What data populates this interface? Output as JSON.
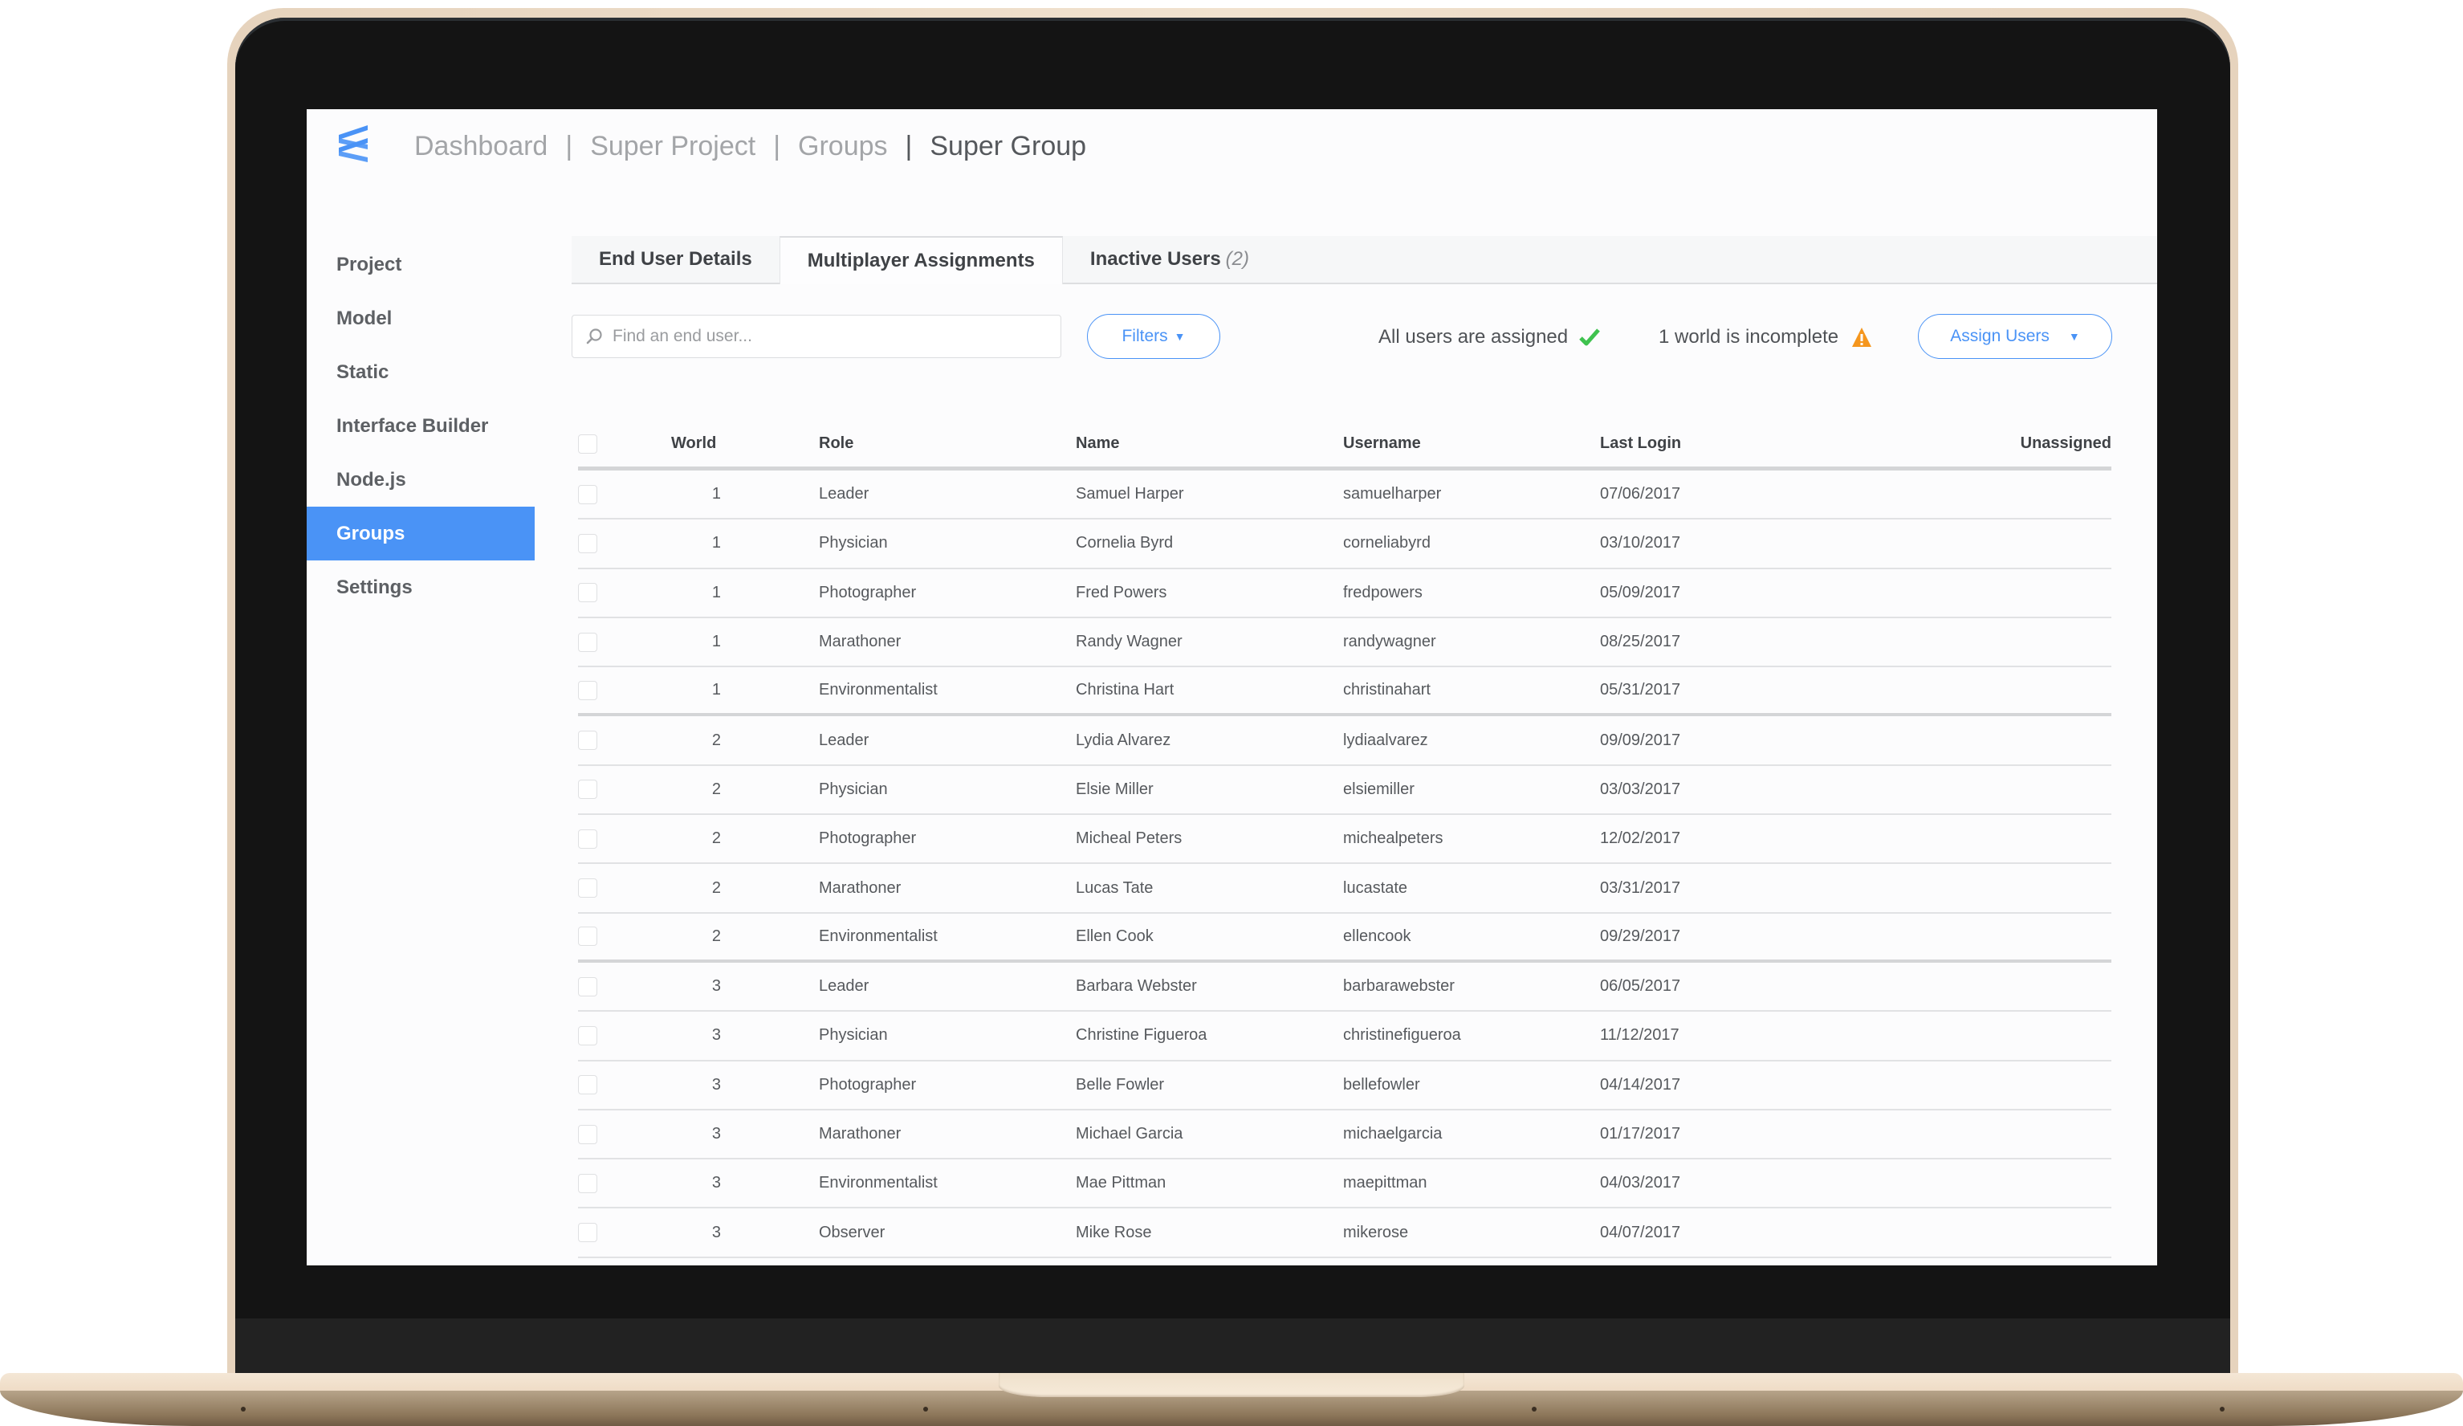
{
  "breadcrumb": [
    "Dashboard",
    "Super Project",
    "Groups",
    "Super Group"
  ],
  "sidebar": {
    "items": [
      {
        "label": "Project",
        "active": false
      },
      {
        "label": "Model",
        "active": false
      },
      {
        "label": "Static",
        "active": false
      },
      {
        "label": "Interface Builder",
        "active": false
      },
      {
        "label": "Node.js",
        "active": false
      },
      {
        "label": "Groups",
        "active": true
      },
      {
        "label": "Settings",
        "active": false
      }
    ]
  },
  "tabs": [
    {
      "label": "End User Details",
      "count": "",
      "active": false
    },
    {
      "label": "Multiplayer Assignments",
      "count": "",
      "active": true
    },
    {
      "label": "Inactive Users",
      "count": "(2)",
      "active": false
    }
  ],
  "toolbar": {
    "search_placeholder": "Find an end user...",
    "search_value": "",
    "filters_label": "Filters",
    "status_assigned": "All users are assigned",
    "status_incomplete": "1 world is incomplete",
    "assign_label": "Assign Users"
  },
  "colors": {
    "accent": "#4a93f6",
    "success": "#3fc24f",
    "warning": "#f5961e"
  },
  "table": {
    "headers": {
      "world": "World",
      "role": "Role",
      "name": "Name",
      "username": "Username",
      "last_login": "Last Login",
      "unassigned": "Unassigned"
    },
    "rows": [
      {
        "world": "1",
        "role": "Leader",
        "name": "Samuel Harper",
        "username": "samuelharper",
        "last_login": "07/06/2017",
        "unassigned": ""
      },
      {
        "world": "1",
        "role": "Physician",
        "name": "Cornelia Byrd",
        "username": "corneliabyrd",
        "last_login": "03/10/2017",
        "unassigned": ""
      },
      {
        "world": "1",
        "role": "Photographer",
        "name": "Fred Powers",
        "username": "fredpowers",
        "last_login": "05/09/2017",
        "unassigned": ""
      },
      {
        "world": "1",
        "role": "Marathoner",
        "name": "Randy Wagner",
        "username": "randywagner",
        "last_login": "08/25/2017",
        "unassigned": ""
      },
      {
        "world": "1",
        "role": "Environmentalist",
        "name": "Christina Hart",
        "username": "christinahart",
        "last_login": "05/31/2017",
        "unassigned": ""
      },
      {
        "world": "2",
        "role": "Leader",
        "name": "Lydia Alvarez",
        "username": "lydiaalvarez",
        "last_login": "09/09/2017",
        "unassigned": ""
      },
      {
        "world": "2",
        "role": "Physician",
        "name": "Elsie Miller",
        "username": "elsiemiller",
        "last_login": "03/03/2017",
        "unassigned": ""
      },
      {
        "world": "2",
        "role": "Photographer",
        "name": "Micheal Peters",
        "username": "michealpeters",
        "last_login": "12/02/2017",
        "unassigned": ""
      },
      {
        "world": "2",
        "role": "Marathoner",
        "name": "Lucas Tate",
        "username": "lucastate",
        "last_login": "03/31/2017",
        "unassigned": ""
      },
      {
        "world": "2",
        "role": "Environmentalist",
        "name": "Ellen Cook",
        "username": "ellencook",
        "last_login": "09/29/2017",
        "unassigned": ""
      },
      {
        "world": "3",
        "role": "Leader",
        "name": "Barbara Webster",
        "username": "barbarawebster",
        "last_login": "06/05/2017",
        "unassigned": ""
      },
      {
        "world": "3",
        "role": "Physician",
        "name": "Christine Figueroa",
        "username": "christinefigueroa",
        "last_login": "11/12/2017",
        "unassigned": ""
      },
      {
        "world": "3",
        "role": "Photographer",
        "name": "Belle Fowler",
        "username": "bellefowler",
        "last_login": "04/14/2017",
        "unassigned": ""
      },
      {
        "world": "3",
        "role": "Marathoner",
        "name": "Michael Garcia",
        "username": "michaelgarcia",
        "last_login": "01/17/2017",
        "unassigned": ""
      },
      {
        "world": "3",
        "role": "Environmentalist",
        "name": "Mae Pittman",
        "username": "maepittman",
        "last_login": "04/03/2017",
        "unassigned": ""
      },
      {
        "world": "3",
        "role": "Observer",
        "name": "Mike Rose",
        "username": "mikerose",
        "last_login": "04/07/2017",
        "unassigned": ""
      }
    ]
  }
}
